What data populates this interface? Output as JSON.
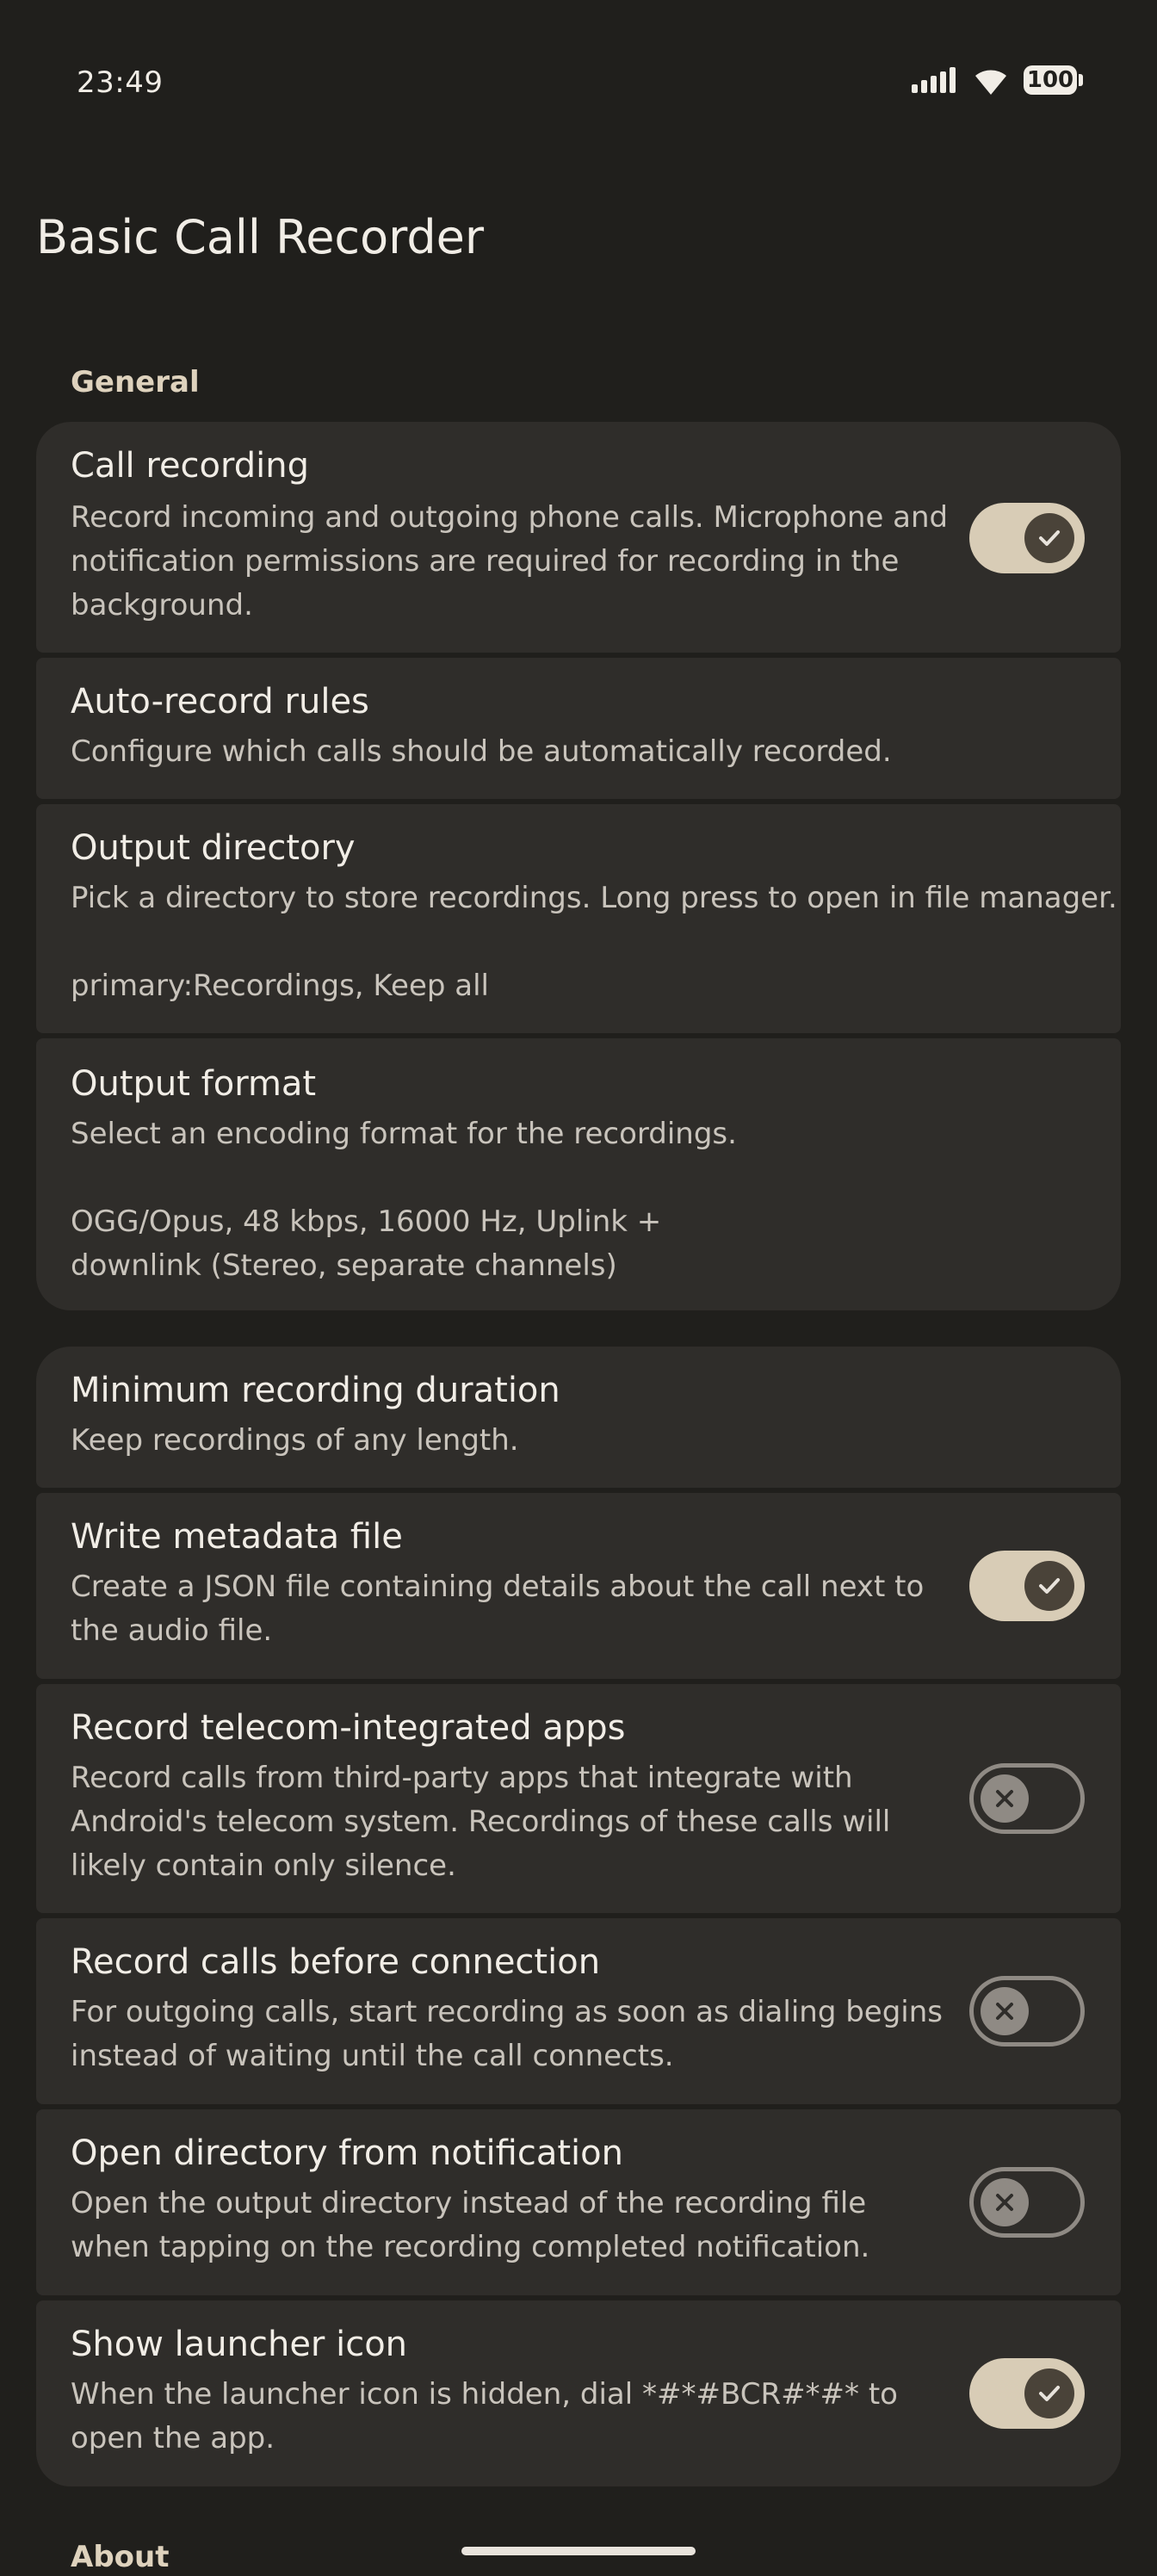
{
  "status_bar": {
    "time": "23:49",
    "battery": "100",
    "icons": [
      "signal-icon",
      "wifi-icon",
      "battery-icon"
    ]
  },
  "title": "Basic Call Recorder",
  "sections": {
    "general": "General",
    "about": "About"
  },
  "items": {
    "call_recording": {
      "title": "Call recording",
      "desc": "Record incoming and outgoing phone calls. Microphone and notification permissions are required for recording in the background.",
      "toggle": "on"
    },
    "auto_record": {
      "title": "Auto-record rules",
      "desc": "Configure which calls should be automatically recorded."
    },
    "output_dir": {
      "title": "Output directory",
      "desc": "Pick a directory to store recordings. Long press to open in file manager.",
      "value": "primary:Recordings, Keep all"
    },
    "output_format": {
      "title": "Output format",
      "desc": "Select an encoding format for the recordings.",
      "value": "OGG/Opus, 48 kbps, 16000 Hz, Uplink + downlink (Stereo, separate channels)"
    },
    "min_duration": {
      "title": "Minimum recording duration",
      "desc": "Keep recordings of any length."
    },
    "metadata": {
      "title": "Write metadata file",
      "desc": "Create a JSON file containing details about the call next to the audio file.",
      "toggle": "on"
    },
    "telecom_apps": {
      "title": "Record telecom-integrated apps",
      "desc": "Record calls from third-party apps that integrate with Android's telecom system. Recordings of these calls will likely contain only silence.",
      "toggle": "off"
    },
    "before_connection": {
      "title": "Record calls before connection",
      "desc": "For outgoing calls, start recording as soon as dialing begins instead of waiting until the call connects.",
      "toggle": "off"
    },
    "open_dir": {
      "title": "Open directory from notification",
      "desc": "Open the output directory instead of the recording file when tapping on the recording completed notification.",
      "toggle": "off"
    },
    "launcher_icon": {
      "title": "Show launcher icon",
      "desc": "When the launcher icon is hidden, dial *#*#BCR#*#* to open the app.",
      "toggle": "on"
    }
  },
  "colors": {
    "background": "#201f1c",
    "card": "#2f2d2a",
    "accent": "#d8ccb6"
  }
}
